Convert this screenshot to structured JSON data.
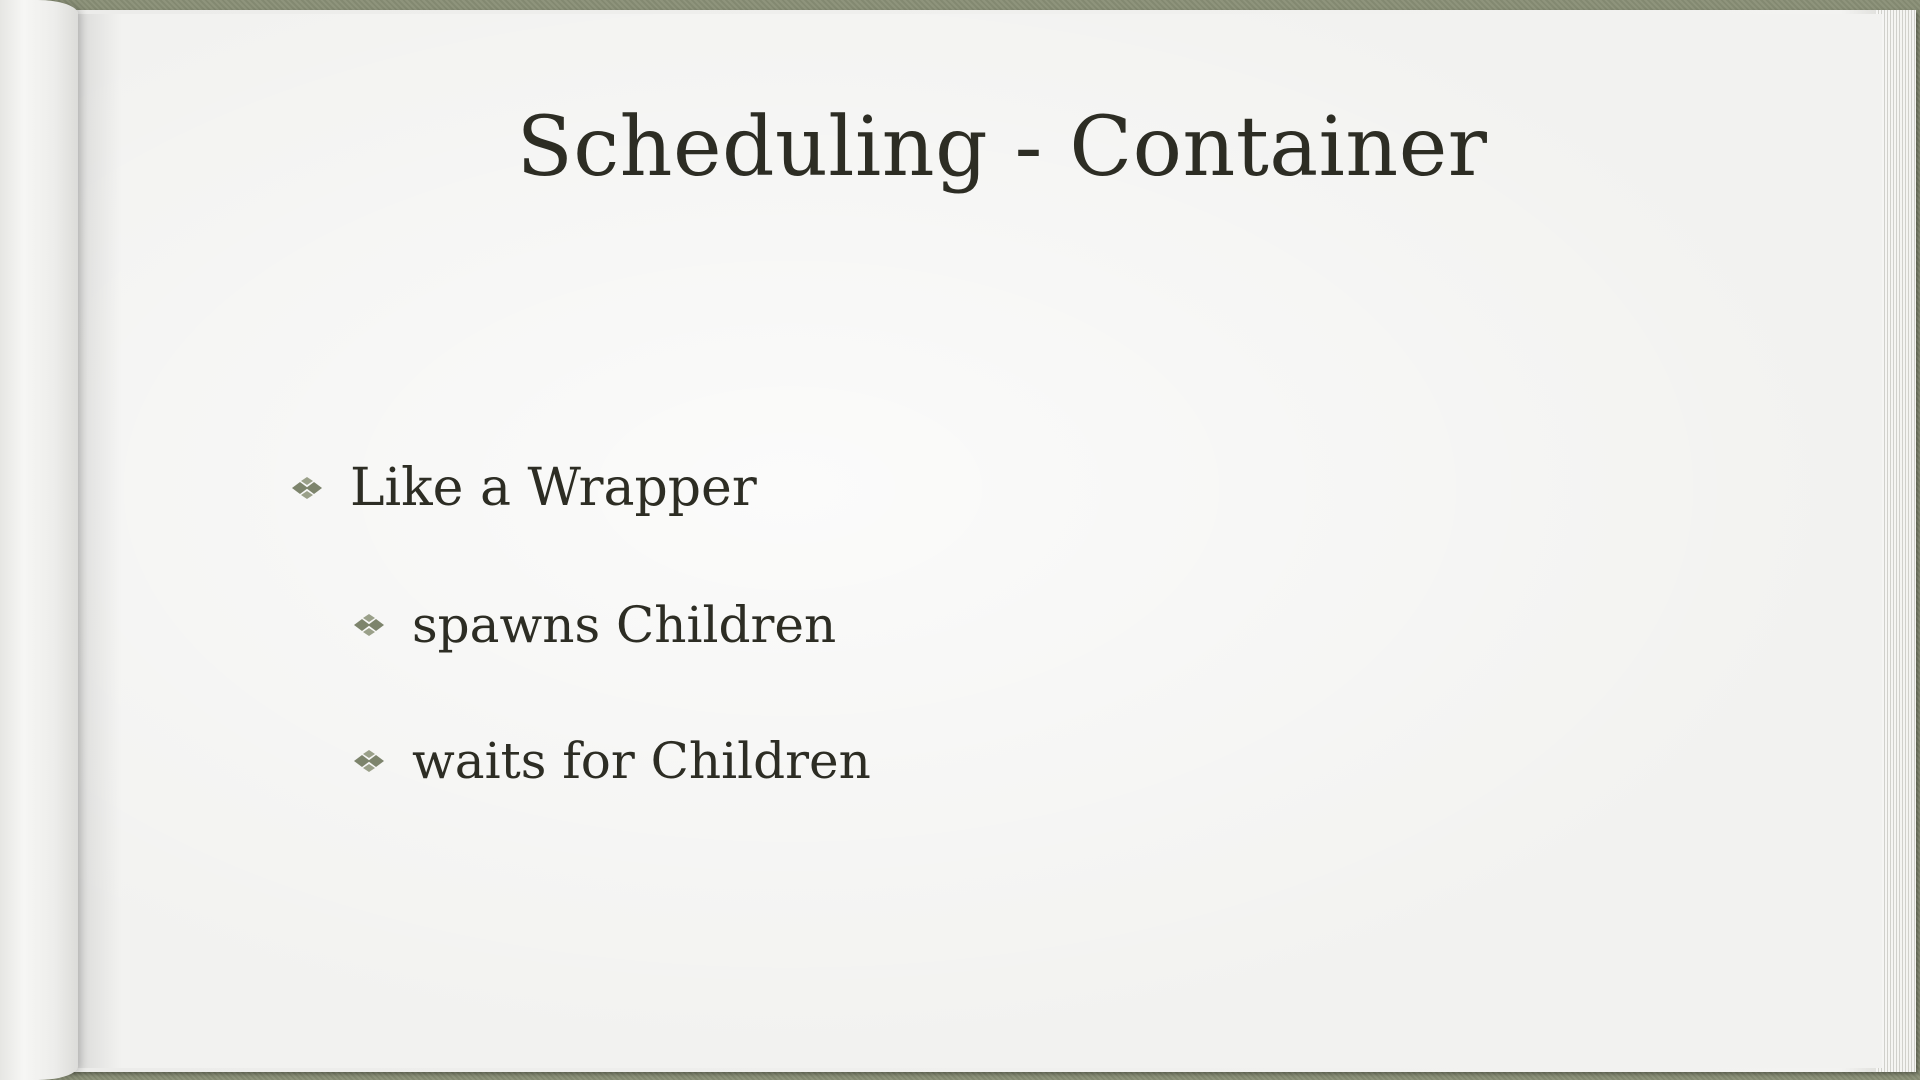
{
  "slide": {
    "title": "Scheduling - Container",
    "bullets": [
      {
        "text": "Like a Wrapper",
        "level": 1
      },
      {
        "text": "spawns Children",
        "level": 2
      },
      {
        "text": "waits for Children",
        "level": 2
      }
    ]
  },
  "colors": {
    "text": "#2d2d24",
    "bullet_icon": "#7d846c",
    "paper": "#f2f2f0",
    "cover": "#8a9077"
  },
  "icons": {
    "bullet": "fleuron-diamond-icon"
  }
}
